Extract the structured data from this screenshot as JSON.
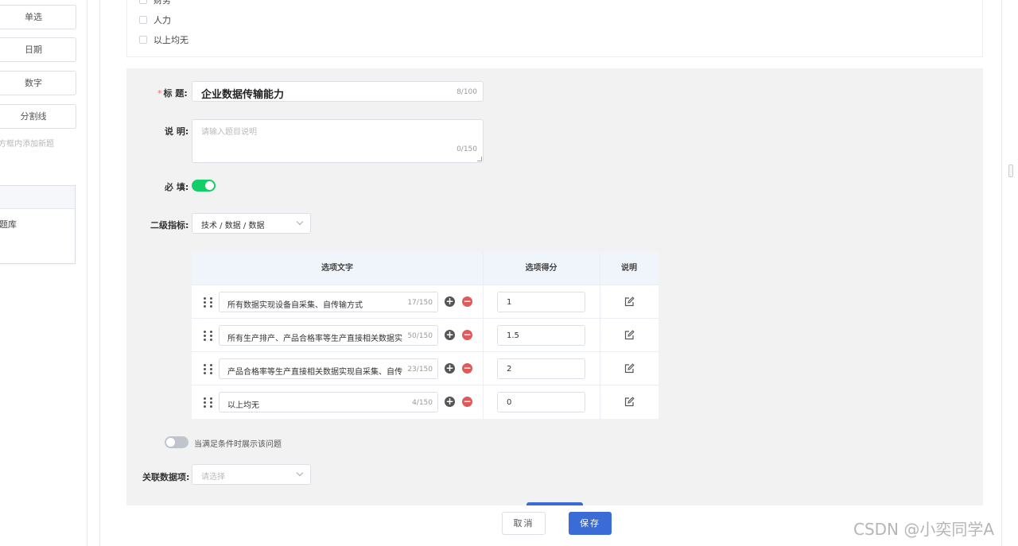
{
  "left_panel": {
    "type_buttons": [
      "单选",
      "日期",
      "数字",
      "分割线"
    ],
    "hint": "方框内添加新题",
    "library_item": "题库"
  },
  "prev_question": {
    "options": [
      "财务",
      "人力",
      "以上均无"
    ]
  },
  "form": {
    "title_label": "标 题:",
    "title_value": "企业数据传输能力",
    "title_counter": "8/100",
    "desc_label": "说 明:",
    "desc_placeholder": "请输入题目说明",
    "desc_counter": "0/150",
    "required_label": "必 填:",
    "required_on": true,
    "indicator_label": "二级指标:",
    "indicator_value": "技术 / 数据 / 数据",
    "condition_label": "当满足条件时展示该问题",
    "condition_on": false,
    "related_label": "关联数据项:",
    "related_placeholder": "请选择"
  },
  "options_table": {
    "headers": [
      "选项文字",
      "选项得分",
      "说明"
    ],
    "rows": [
      {
        "text": "所有数据实现设备自采集、自传输方式",
        "counter": "17/150",
        "score": "1"
      },
      {
        "text": "所有生产排产、产品合格率等生产直接相关数据实",
        "counter": "50/150",
        "score": "1.5"
      },
      {
        "text": "产品合格率等生产直接相关数据实现自采集、自传",
        "counter": "23/150",
        "score": "2"
      },
      {
        "text": "以上均无",
        "counter": "4/150",
        "score": "0"
      }
    ]
  },
  "footer": {
    "cancel_label": "取消",
    "save_label": "保存"
  },
  "watermark": "CSDN @小奕同学A",
  "colors": {
    "accent": "#3b6bd6",
    "toggle_on": "#13ce66",
    "danger": "#e05a5a"
  }
}
